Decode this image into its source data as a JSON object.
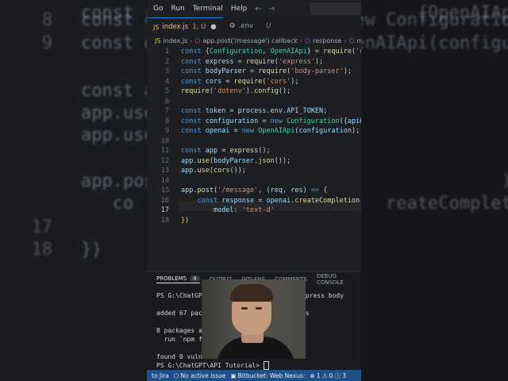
{
  "background": {
    "lines": [
      {
        "ln": "",
        "code": "const {Co                       {OpenAIApi} = require('openai');"
      },
      {
        "ln": "8",
        "code": "const co       uration = new Configuration({apiKey"
      },
      {
        "ln": "9",
        "code": "const o       nai = new OpenAIApi(configuration);"
      },
      {
        "ln": "",
        "code": ""
      },
      {
        "ln": "",
        "code": "const a"
      },
      {
        "ln": "",
        "code": "app.use"
      },
      {
        "ln": "",
        "code": "app.use"
      },
      {
        "ln": "",
        "code": ""
      },
      {
        "ln": "",
        "code": "app.pos                                 ) => {"
      },
      {
        "ln": "",
        "code": "   co                        reateCompletion({"
      },
      {
        "ln": "17",
        "code": ""
      },
      {
        "ln": "18",
        "code": "})"
      }
    ]
  },
  "menubar": {
    "items": [
      "Go",
      "Run",
      "Terminal",
      "Help"
    ],
    "back": "←",
    "forward": "→"
  },
  "tabs": [
    {
      "label": "index.js",
      "suffix": "1, U",
      "close": "●"
    },
    {
      "label": ".env",
      "suffix": "U"
    }
  ],
  "breadcrumbs": {
    "file": "index.js",
    "symbol": "app.post('/message') callback",
    "inner": "response",
    "more": "mo"
  },
  "code_lines": [
    {
      "n": "1",
      "segs": [
        [
          "k",
          "const "
        ],
        [
          "p",
          "{"
        ],
        [
          "c",
          "Configuration"
        ],
        [
          "p",
          ", "
        ],
        [
          "c",
          "OpenAIApi"
        ],
        [
          "p",
          "} = "
        ],
        [
          "f",
          "require"
        ],
        [
          "p",
          "("
        ],
        [
          "s",
          "'op"
        ]
      ]
    },
    {
      "n": "2",
      "segs": [
        [
          "k",
          "const "
        ],
        [
          "v",
          "express"
        ],
        [
          "p",
          " = "
        ],
        [
          "f",
          "require"
        ],
        [
          "p",
          "("
        ],
        [
          "s",
          "'express'"
        ],
        [
          "p",
          ");"
        ]
      ]
    },
    {
      "n": "3",
      "segs": [
        [
          "k",
          "const "
        ],
        [
          "v",
          "bodyParser"
        ],
        [
          "p",
          " = "
        ],
        [
          "f",
          "require"
        ],
        [
          "p",
          "("
        ],
        [
          "s",
          "'body-parser'"
        ],
        [
          "p",
          ");"
        ]
      ]
    },
    {
      "n": "4",
      "segs": [
        [
          "k",
          "const "
        ],
        [
          "v",
          "cors"
        ],
        [
          "p",
          " = "
        ],
        [
          "f",
          "require"
        ],
        [
          "p",
          "("
        ],
        [
          "s",
          "'cors'"
        ],
        [
          "p",
          ");"
        ]
      ]
    },
    {
      "n": "5",
      "segs": [
        [
          "f",
          "require"
        ],
        [
          "p",
          "("
        ],
        [
          "s",
          "'dotenv'"
        ],
        [
          "p",
          ")."
        ],
        [
          "f",
          "config"
        ],
        [
          "p",
          "();"
        ]
      ]
    },
    {
      "n": "6",
      "segs": []
    },
    {
      "n": "7",
      "segs": [
        [
          "k",
          "const "
        ],
        [
          "v",
          "token"
        ],
        [
          "p",
          " = "
        ],
        [
          "v",
          "process"
        ],
        [
          "p",
          "."
        ],
        [
          "v",
          "env"
        ],
        [
          "p",
          "."
        ],
        [
          "v",
          "API_TOKEN"
        ],
        [
          "p",
          ";"
        ]
      ]
    },
    {
      "n": "8",
      "segs": [
        [
          "k",
          "const "
        ],
        [
          "v",
          "configuration"
        ],
        [
          "p",
          " = "
        ],
        [
          "k",
          "new "
        ],
        [
          "c",
          "Configuration"
        ],
        [
          "p",
          "({"
        ],
        [
          "v",
          "apiKe"
        ]
      ]
    },
    {
      "n": "9",
      "segs": [
        [
          "k",
          "const "
        ],
        [
          "v",
          "openai"
        ],
        [
          "p",
          " = "
        ],
        [
          "k",
          "new "
        ],
        [
          "c",
          "OpenAIApi"
        ],
        [
          "p",
          "("
        ],
        [
          "v",
          "configuration"
        ],
        [
          "p",
          ");"
        ]
      ]
    },
    {
      "n": "10",
      "segs": []
    },
    {
      "n": "11",
      "segs": [
        [
          "k",
          "const "
        ],
        [
          "v",
          "app"
        ],
        [
          "p",
          " = "
        ],
        [
          "f",
          "express"
        ],
        [
          "p",
          "();"
        ]
      ]
    },
    {
      "n": "12",
      "segs": [
        [
          "v",
          "app"
        ],
        [
          "p",
          "."
        ],
        [
          "f",
          "use"
        ],
        [
          "p",
          "("
        ],
        [
          "v",
          "bodyParser"
        ],
        [
          "p",
          "."
        ],
        [
          "f",
          "json"
        ],
        [
          "p",
          "());"
        ]
      ]
    },
    {
      "n": "13",
      "segs": [
        [
          "v",
          "app"
        ],
        [
          "p",
          "."
        ],
        [
          "f",
          "use"
        ],
        [
          "p",
          "("
        ],
        [
          "f",
          "cors"
        ],
        [
          "p",
          "());"
        ]
      ]
    },
    {
      "n": "14",
      "segs": []
    },
    {
      "n": "15",
      "segs": [
        [
          "v",
          "app"
        ],
        [
          "p",
          "."
        ],
        [
          "f",
          "post"
        ],
        [
          "p",
          "("
        ],
        [
          "s",
          "'/message'"
        ],
        [
          "p",
          ", ("
        ],
        [
          "v",
          "req"
        ],
        [
          "p",
          ", "
        ],
        [
          "v",
          "res"
        ],
        [
          "p",
          ") "
        ],
        [
          "k",
          "=> "
        ],
        [
          "y",
          "{"
        ]
      ]
    },
    {
      "n": "16",
      "segs": [
        [
          "p",
          "    "
        ],
        [
          "k",
          "const "
        ],
        [
          "v",
          "response"
        ],
        [
          "p",
          " = "
        ],
        [
          "v",
          "openai"
        ],
        [
          "p",
          "."
        ],
        [
          "f",
          "createCompletion"
        ],
        [
          "p",
          "("
        ],
        [
          "m",
          "{"
        ]
      ]
    },
    {
      "n": "17",
      "segs": [
        [
          "p",
          "        "
        ],
        [
          "v",
          "model"
        ],
        [
          "p",
          ": "
        ],
        [
          "s",
          "'text-d'"
        ]
      ]
    },
    {
      "n": "18",
      "segs": [
        [
          "y",
          "}"
        ],
        [
          "p",
          ")"
        ]
      ]
    }
  ],
  "panel": {
    "tabs": [
      {
        "label": "PROBLEMS",
        "badge": "4"
      },
      {
        "label": "OUTPUT"
      },
      {
        "label": "GITLENS"
      },
      {
        "label": "COMMENTS"
      },
      {
        "label": "DEBUG CONSOLE"
      }
    ],
    "terminal_lines": [
      "PS G:\\ChatGPT                     ai express body",
      "",
      "added 67 pac                  ages in 4s",
      "",
      "8 packages a",
      "  run `npm f",
      "",
      "found 0 vulnerabilities",
      "PS G:\\ChatGPT\\API Tutorial> "
    ]
  },
  "statusbar": {
    "jira": "to Jira",
    "issue": "No active issue",
    "bitbucket": "Bitbucket: Web Nexus:",
    "errors": "1",
    "warnings": "0",
    "info": "3"
  },
  "colors": {
    "editor_bg": "#1e1f22",
    "status_bg": "#1f4f86",
    "accent_tab": "#2b7fd6"
  }
}
